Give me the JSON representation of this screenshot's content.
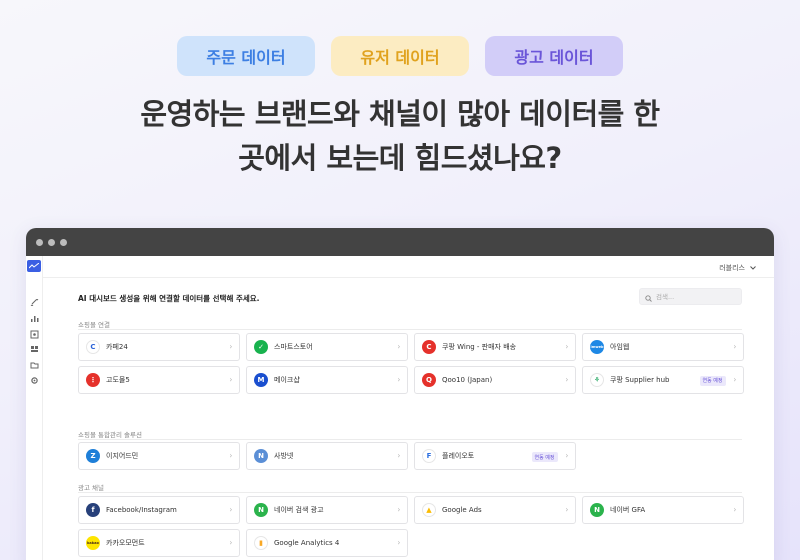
{
  "pills": [
    "주문 데이터",
    "유저 데이터",
    "광고 데이터"
  ],
  "headline": [
    "운영하는 브랜드와 채널이 많아 데이터를 한",
    "곳에서 보는데 힘드셨나요?"
  ],
  "app": {
    "workspace": "러블리스",
    "intro": "AI 대시보드 생성을 위해 연결할 데이터를 선택해 주세요.",
    "search_placeholder": "검색...",
    "sections": [
      {
        "title": "쇼핑몰 연결",
        "items": [
          {
            "label": "카페24",
            "icon_text": "C",
            "icon_bg": "#ffffff",
            "icon_fg": "#2d64d8",
            "icon": "cafe24-icon"
          },
          {
            "label": "스마트스토어",
            "icon_text": "✓",
            "icon_bg": "#18b24e",
            "icon_fg": "#ffffff",
            "icon": "smartstore-icon"
          },
          {
            "label": "쿠팡 Wing - 판매자 배송",
            "icon_text": "C",
            "icon_bg": "#e5312b",
            "icon_fg": "#ffffff",
            "icon": "coupang-wing-icon"
          },
          {
            "label": "아임웹",
            "icon_text": "imweb",
            "icon_bg": "#1e88e5",
            "icon_fg": "#ffffff",
            "icon": "imweb-icon"
          },
          {
            "label": "고도몰5",
            "icon_text": "⋮",
            "icon_bg": "#e5312b",
            "icon_fg": "#ffffff",
            "icon": "godomall-icon"
          },
          {
            "label": "메이크샵",
            "icon_text": "M",
            "icon_bg": "#1a4fcf",
            "icon_fg": "#ffffff",
            "icon": "makeshop-icon"
          },
          {
            "label": "Qoo10 (Japan)",
            "icon_text": "Q",
            "icon_bg": "#e5312b",
            "icon_fg": "#ffffff",
            "icon": "qoo10-icon"
          },
          {
            "label": "쿠팡 Supplier hub",
            "icon_text": "⚘",
            "icon_bg": "#ffffff",
            "icon_fg": "#1aa35a",
            "icon": "coupang-supplier-icon",
            "badge": "연동 예정"
          }
        ]
      },
      {
        "title": "쇼핑몰 통합관리 솔루션",
        "items": [
          {
            "label": "이지어드민",
            "icon_text": "Z",
            "icon_bg": "#1e7fd8",
            "icon_fg": "#ffffff",
            "icon": "ezadmin-icon"
          },
          {
            "label": "사방넷",
            "icon_text": "N",
            "icon_bg": "#5b8fd6",
            "icon_fg": "#ffffff",
            "icon": "sabangnet-icon"
          },
          {
            "label": "플레이오토",
            "icon_text": "F",
            "icon_bg": "#ffffff",
            "icon_fg": "#2a6ee0",
            "icon": "playauto-icon",
            "badge": "연동 예정"
          }
        ]
      },
      {
        "title": "광고 채널",
        "items": [
          {
            "label": "Facebook/Instagram",
            "icon_text": "f",
            "icon_bg": "#27407a",
            "icon_fg": "#ffffff",
            "icon": "facebook-icon"
          },
          {
            "label": "네이버 검색 광고",
            "icon_text": "N",
            "icon_bg": "#2bb34c",
            "icon_fg": "#ffffff",
            "icon": "naver-search-ad-icon"
          },
          {
            "label": "Google Ads",
            "icon_text": "▲",
            "icon_bg": "#ffffff",
            "icon_fg": "#fbbc04",
            "icon": "google-ads-icon"
          },
          {
            "label": "네이버 GFA",
            "icon_text": "N",
            "icon_bg": "#2bb34c",
            "icon_fg": "#ffffff",
            "icon": "naver-gfa-icon"
          },
          {
            "label": "카카오모먼트",
            "icon_text": "kakao",
            "icon_bg": "#fee500",
            "icon_fg": "#3a1d1d",
            "icon": "kakao-moment-icon"
          },
          {
            "label": "Google Analytics 4",
            "icon_text": "▮",
            "icon_bg": "#ffffff",
            "icon_fg": "#f9a825",
            "icon": "google-analytics-icon"
          }
        ]
      }
    ]
  }
}
